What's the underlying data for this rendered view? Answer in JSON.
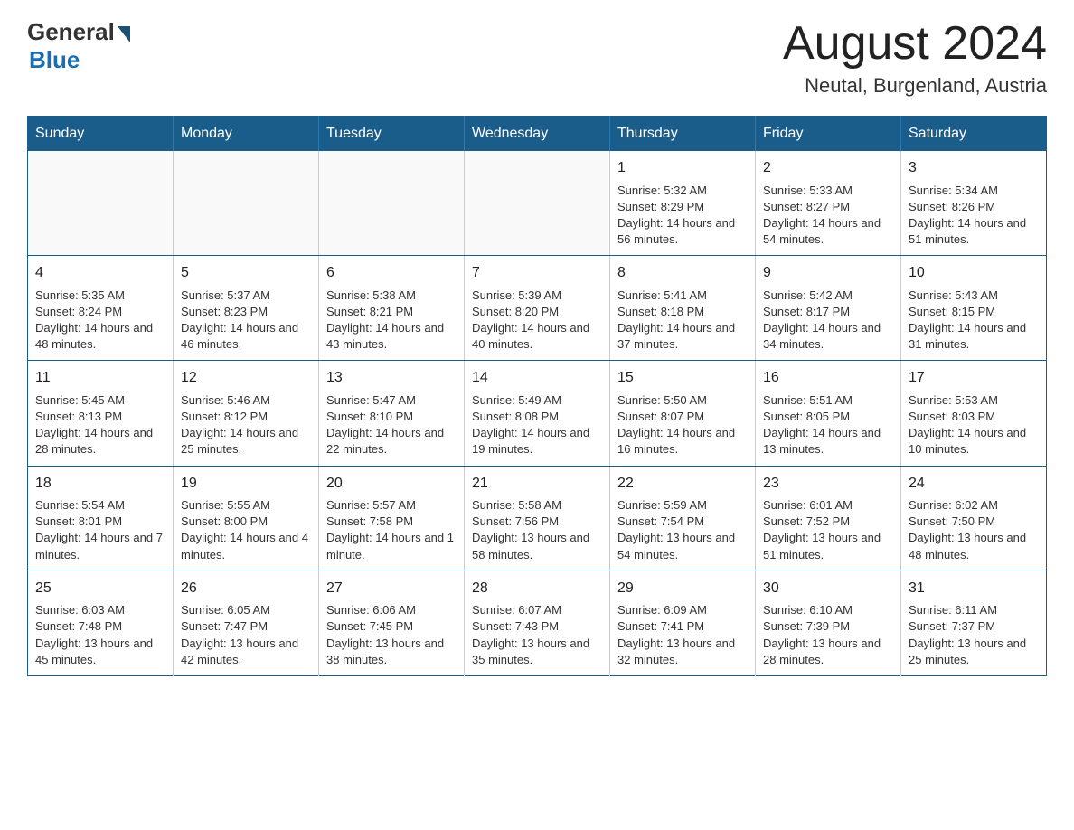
{
  "header": {
    "logo_general": "General",
    "logo_blue": "Blue",
    "month_title": "August 2024",
    "location": "Neutal, Burgenland, Austria"
  },
  "days_of_week": [
    "Sunday",
    "Monday",
    "Tuesday",
    "Wednesday",
    "Thursday",
    "Friday",
    "Saturday"
  ],
  "weeks": [
    [
      {
        "day": "",
        "info": ""
      },
      {
        "day": "",
        "info": ""
      },
      {
        "day": "",
        "info": ""
      },
      {
        "day": "",
        "info": ""
      },
      {
        "day": "1",
        "info": "Sunrise: 5:32 AM\nSunset: 8:29 PM\nDaylight: 14 hours and 56 minutes."
      },
      {
        "day": "2",
        "info": "Sunrise: 5:33 AM\nSunset: 8:27 PM\nDaylight: 14 hours and 54 minutes."
      },
      {
        "day": "3",
        "info": "Sunrise: 5:34 AM\nSunset: 8:26 PM\nDaylight: 14 hours and 51 minutes."
      }
    ],
    [
      {
        "day": "4",
        "info": "Sunrise: 5:35 AM\nSunset: 8:24 PM\nDaylight: 14 hours and 48 minutes."
      },
      {
        "day": "5",
        "info": "Sunrise: 5:37 AM\nSunset: 8:23 PM\nDaylight: 14 hours and 46 minutes."
      },
      {
        "day": "6",
        "info": "Sunrise: 5:38 AM\nSunset: 8:21 PM\nDaylight: 14 hours and 43 minutes."
      },
      {
        "day": "7",
        "info": "Sunrise: 5:39 AM\nSunset: 8:20 PM\nDaylight: 14 hours and 40 minutes."
      },
      {
        "day": "8",
        "info": "Sunrise: 5:41 AM\nSunset: 8:18 PM\nDaylight: 14 hours and 37 minutes."
      },
      {
        "day": "9",
        "info": "Sunrise: 5:42 AM\nSunset: 8:17 PM\nDaylight: 14 hours and 34 minutes."
      },
      {
        "day": "10",
        "info": "Sunrise: 5:43 AM\nSunset: 8:15 PM\nDaylight: 14 hours and 31 minutes."
      }
    ],
    [
      {
        "day": "11",
        "info": "Sunrise: 5:45 AM\nSunset: 8:13 PM\nDaylight: 14 hours and 28 minutes."
      },
      {
        "day": "12",
        "info": "Sunrise: 5:46 AM\nSunset: 8:12 PM\nDaylight: 14 hours and 25 minutes."
      },
      {
        "day": "13",
        "info": "Sunrise: 5:47 AM\nSunset: 8:10 PM\nDaylight: 14 hours and 22 minutes."
      },
      {
        "day": "14",
        "info": "Sunrise: 5:49 AM\nSunset: 8:08 PM\nDaylight: 14 hours and 19 minutes."
      },
      {
        "day": "15",
        "info": "Sunrise: 5:50 AM\nSunset: 8:07 PM\nDaylight: 14 hours and 16 minutes."
      },
      {
        "day": "16",
        "info": "Sunrise: 5:51 AM\nSunset: 8:05 PM\nDaylight: 14 hours and 13 minutes."
      },
      {
        "day": "17",
        "info": "Sunrise: 5:53 AM\nSunset: 8:03 PM\nDaylight: 14 hours and 10 minutes."
      }
    ],
    [
      {
        "day": "18",
        "info": "Sunrise: 5:54 AM\nSunset: 8:01 PM\nDaylight: 14 hours and 7 minutes."
      },
      {
        "day": "19",
        "info": "Sunrise: 5:55 AM\nSunset: 8:00 PM\nDaylight: 14 hours and 4 minutes."
      },
      {
        "day": "20",
        "info": "Sunrise: 5:57 AM\nSunset: 7:58 PM\nDaylight: 14 hours and 1 minute."
      },
      {
        "day": "21",
        "info": "Sunrise: 5:58 AM\nSunset: 7:56 PM\nDaylight: 13 hours and 58 minutes."
      },
      {
        "day": "22",
        "info": "Sunrise: 5:59 AM\nSunset: 7:54 PM\nDaylight: 13 hours and 54 minutes."
      },
      {
        "day": "23",
        "info": "Sunrise: 6:01 AM\nSunset: 7:52 PM\nDaylight: 13 hours and 51 minutes."
      },
      {
        "day": "24",
        "info": "Sunrise: 6:02 AM\nSunset: 7:50 PM\nDaylight: 13 hours and 48 minutes."
      }
    ],
    [
      {
        "day": "25",
        "info": "Sunrise: 6:03 AM\nSunset: 7:48 PM\nDaylight: 13 hours and 45 minutes."
      },
      {
        "day": "26",
        "info": "Sunrise: 6:05 AM\nSunset: 7:47 PM\nDaylight: 13 hours and 42 minutes."
      },
      {
        "day": "27",
        "info": "Sunrise: 6:06 AM\nSunset: 7:45 PM\nDaylight: 13 hours and 38 minutes."
      },
      {
        "day": "28",
        "info": "Sunrise: 6:07 AM\nSunset: 7:43 PM\nDaylight: 13 hours and 35 minutes."
      },
      {
        "day": "29",
        "info": "Sunrise: 6:09 AM\nSunset: 7:41 PM\nDaylight: 13 hours and 32 minutes."
      },
      {
        "day": "30",
        "info": "Sunrise: 6:10 AM\nSunset: 7:39 PM\nDaylight: 13 hours and 28 minutes."
      },
      {
        "day": "31",
        "info": "Sunrise: 6:11 AM\nSunset: 7:37 PM\nDaylight: 13 hours and 25 minutes."
      }
    ]
  ]
}
